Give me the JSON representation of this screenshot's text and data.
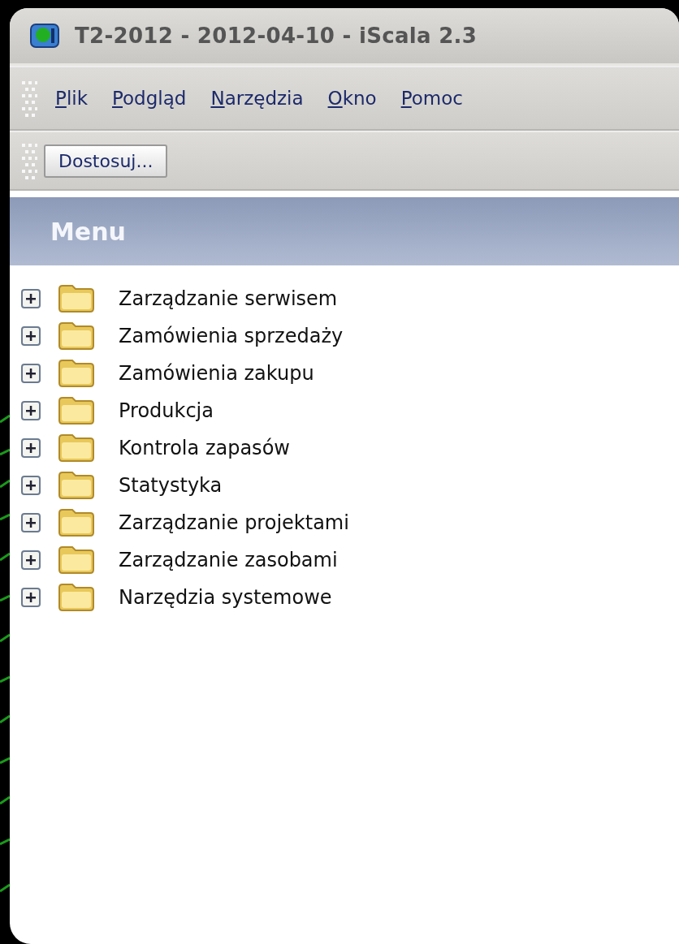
{
  "window": {
    "title": "T2-2012 - 2012-04-10 - iScala 2.3"
  },
  "menu_bar": [
    {
      "label": "Plik",
      "underline_first": true
    },
    {
      "label": "Podgląd",
      "underline_first": true
    },
    {
      "label": "Narzędzia",
      "underline_first": true
    },
    {
      "label": "Okno",
      "underline_first": true
    },
    {
      "label": "Pomoc",
      "underline_first": true
    }
  ],
  "toolbar": {
    "buttons": [
      "Dostosuj..."
    ]
  },
  "panel": {
    "title": "Menu"
  },
  "tree": [
    {
      "label": "Zarządzanie serwisem",
      "expanded": false
    },
    {
      "label": "Zamówienia sprzedaży",
      "expanded": false
    },
    {
      "label": "Zamówienia zakupu",
      "expanded": false
    },
    {
      "label": "Produkcja",
      "expanded": false
    },
    {
      "label": "Kontrola zapasów",
      "expanded": false
    },
    {
      "label": "Statystyka",
      "expanded": false
    },
    {
      "label": "Zarządzanie projektami",
      "expanded": false
    },
    {
      "label": "Zarządzanie zasobami",
      "expanded": false
    },
    {
      "label": "Narzędzia systemowe",
      "expanded": false
    }
  ]
}
